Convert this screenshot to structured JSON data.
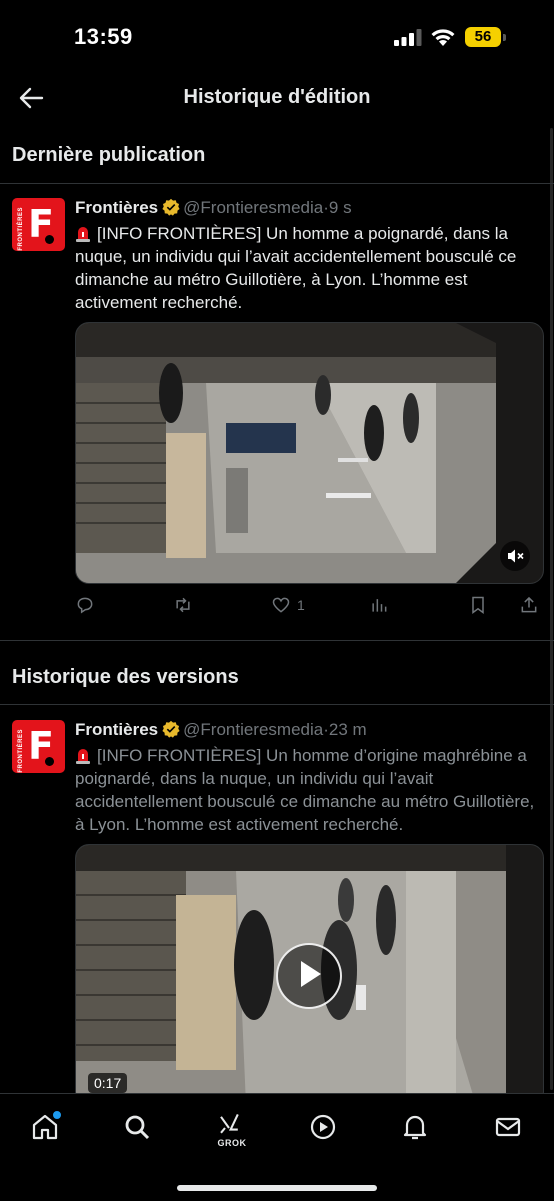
{
  "status_bar": {
    "time": "13:59",
    "battery": "56"
  },
  "header": {
    "title": "Historique d'édition"
  },
  "sections": {
    "latest": "Dernière publication",
    "history": "Historique des versions"
  },
  "latest_tweet": {
    "author": "Frontières",
    "handle": "@Frontieresmedia",
    "separator": "·",
    "time": "9 s",
    "text": "[INFO FRONTIÈRES] Un homme a poignardé, dans la nuque, un individu qui l’avait accidentellement bousculé ce dimanche au métro Guillotière, à Lyon. L’homme est activement recherché.",
    "likes": "1",
    "media": {
      "kind": "video",
      "muted_icon": "speaker-muted-icon"
    }
  },
  "history_tweet": {
    "author": "Frontières",
    "handle": "@Frontieresmedia",
    "separator": "·",
    "time": "23 m",
    "text": "[INFO FRONTIÈRES] Un homme d’origine maghrébine a poignardé, dans la nuque, un individu qui l’avait accidentellement bousculé ce dimanche au métro Guillotière, à Lyon. L’homme est activement recherché.",
    "media": {
      "kind": "video",
      "duration": "0:17",
      "play_icon": "play-icon"
    }
  },
  "avatar": {
    "letter": "F",
    "side_text": "FRONTIÈRES"
  },
  "bottom_nav": {
    "items": [
      {
        "name": "home-icon"
      },
      {
        "name": "search-icon"
      },
      {
        "name": "grok-icon",
        "label": "GROK"
      },
      {
        "name": "video-icon"
      },
      {
        "name": "bell-icon"
      },
      {
        "name": "mail-icon"
      }
    ]
  },
  "colors": {
    "background": "#000000",
    "text": "#e7e9ea",
    "muted": "#71767b",
    "accent": "#1d9bf0",
    "brand_red": "#e3141b",
    "verified": "#e8b92c",
    "battery": "#f5d000"
  }
}
